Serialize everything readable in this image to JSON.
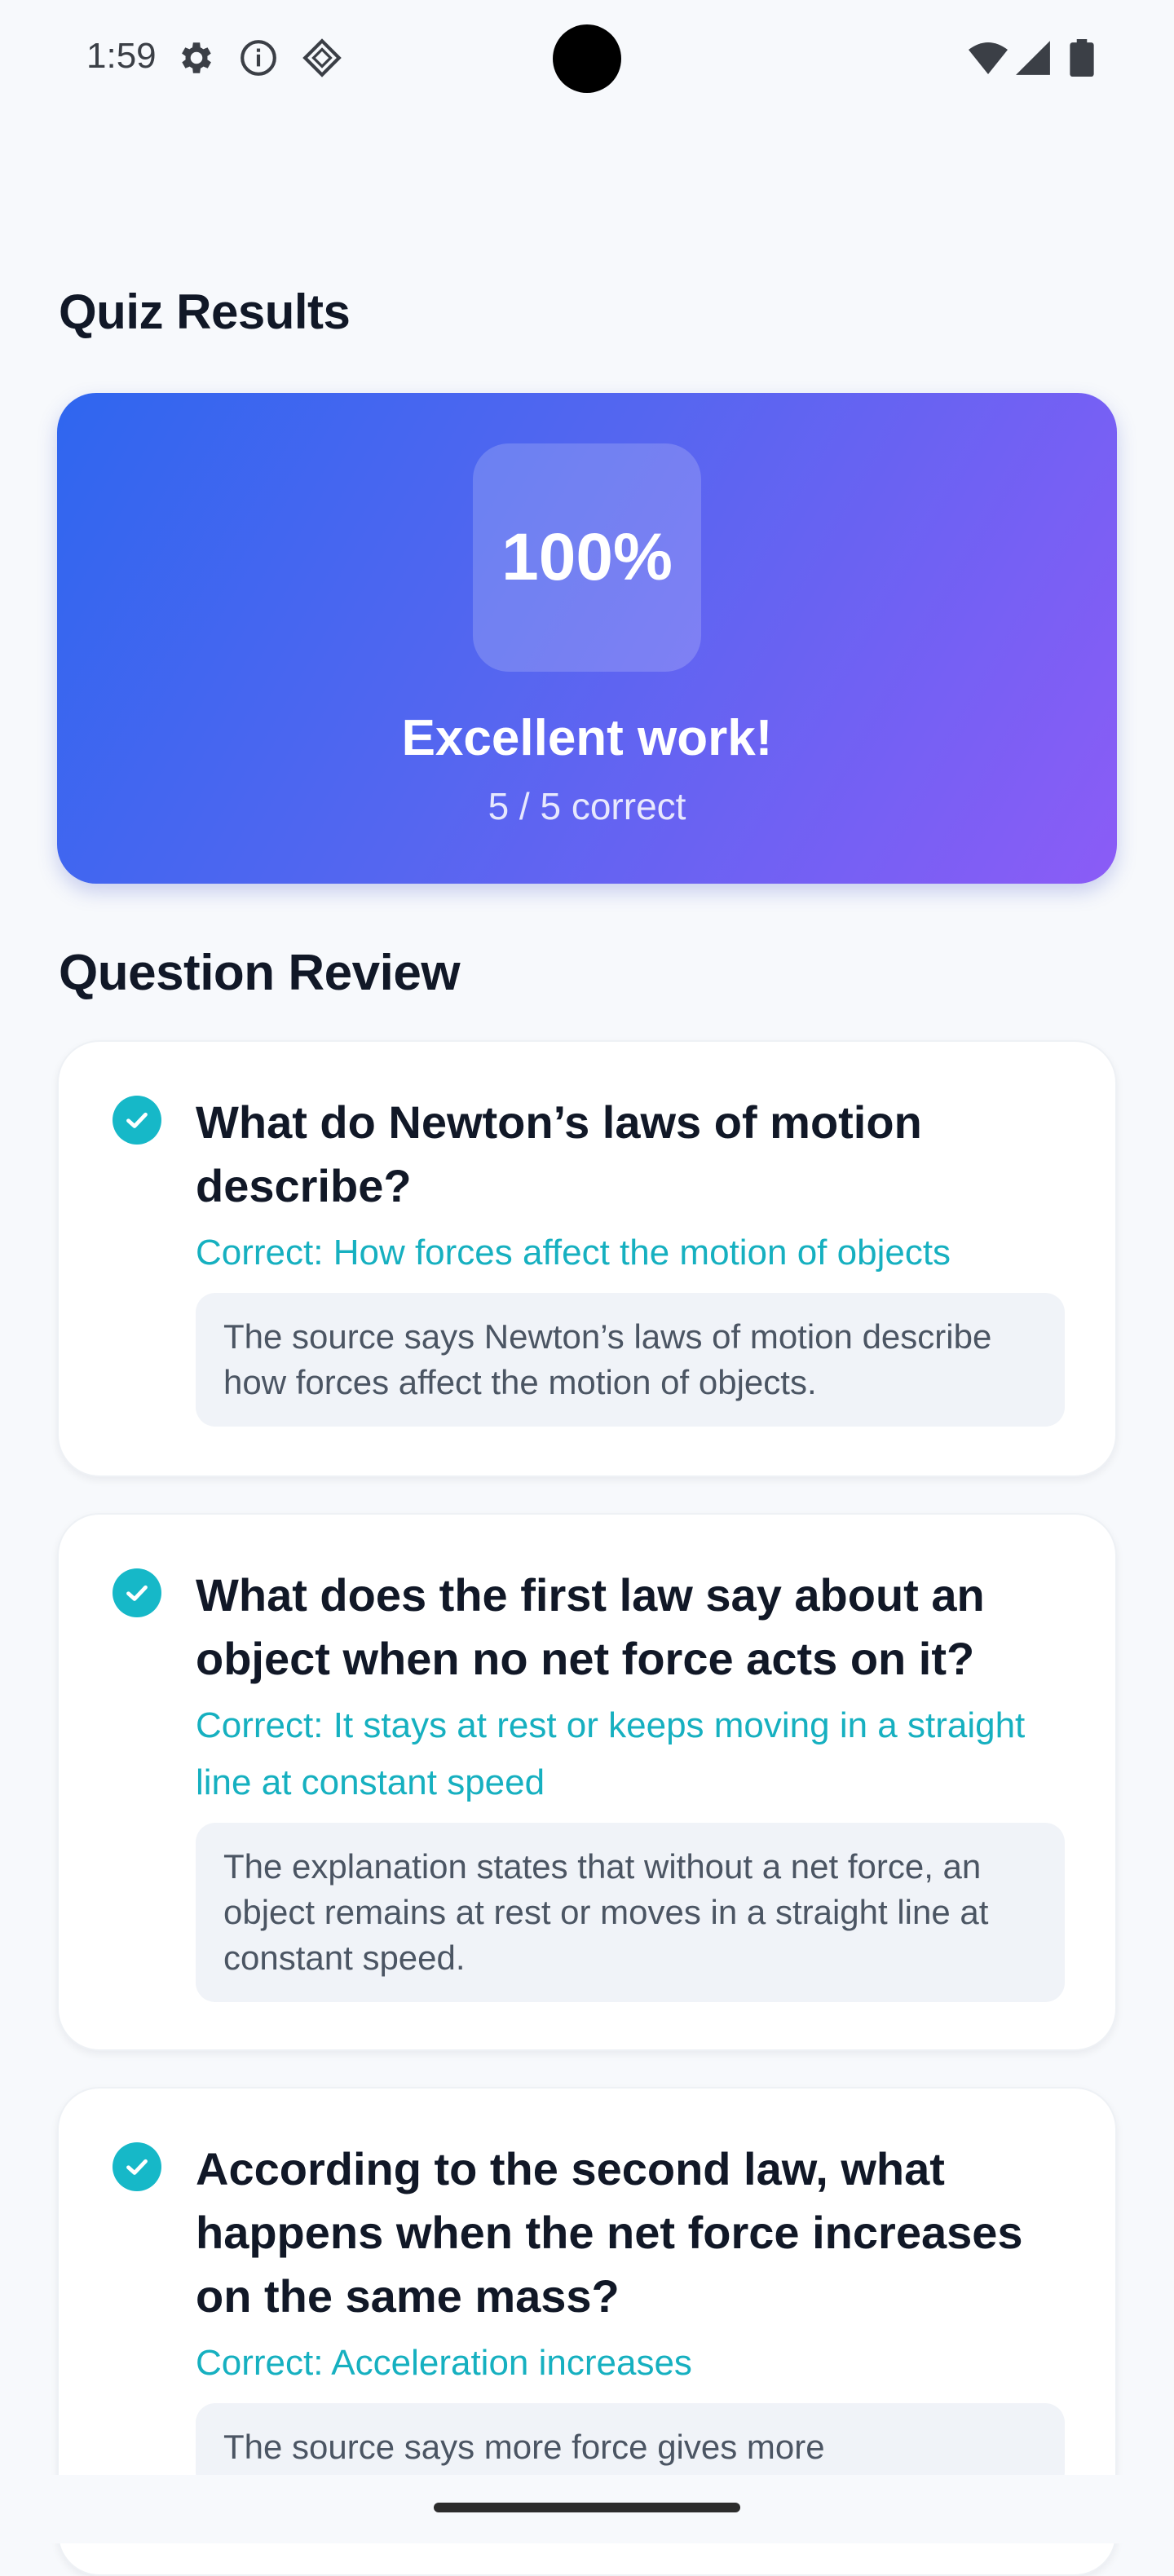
{
  "status_bar": {
    "time": "1:59",
    "left_icons": [
      "gear-icon",
      "info-icon",
      "diamond-icon"
    ],
    "right_icons": [
      "wifi-icon",
      "signal-icon",
      "battery-icon"
    ]
  },
  "page": {
    "title": "Quiz Results",
    "section_title": "Question Review"
  },
  "score": {
    "percent_label": "100%",
    "headline": "Excellent work!",
    "subtitle": "5 / 5 correct",
    "gradient": [
      "#2f66ef",
      "#8b5cf6"
    ]
  },
  "questions": [
    {
      "question": "What do Newton’s laws of motion describe?",
      "correct": "Correct: How forces affect the motion of objects",
      "explanation": "The source says Newton’s laws of motion describe how forces affect the motion of objects.",
      "status": "correct"
    },
    {
      "question": "What does the first law say about an object when no net force acts on it?",
      "correct": "Correct: It stays at rest or keeps moving in a straight line at constant speed",
      "explanation": "The explanation states that without a net force, an object remains at rest or moves in a straight line at constant speed.",
      "status": "correct"
    },
    {
      "question": "According to the second law, what happens when the net force increases on the same mass?",
      "correct": "Correct: Acceleration increases",
      "explanation": "The source says more force gives more",
      "status": "correct"
    }
  ],
  "colors": {
    "accent_teal": "#16b8c8",
    "background": "#f7f9fc"
  }
}
